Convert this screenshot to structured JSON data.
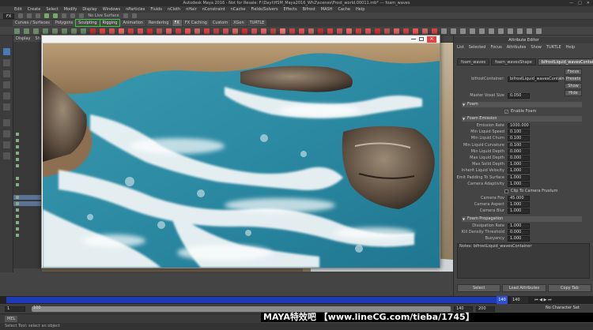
{
  "window": {
    "title": "Autodesk Maya 2016 - Not for Resale: F:\\Dayi\\HSM_Maya2016_Wh2\\scenes\\Frost_world.00011.mb*  ---  foam_waves"
  },
  "menu": [
    "Edit",
    "Create",
    "Select",
    "Modify",
    "Display",
    "Windows",
    "nParticles",
    "Fluids",
    "nCloth",
    "nHair",
    "nConstraint",
    "nCache",
    "Fields/Solvers",
    "Effects",
    "Bifrost",
    "MASH",
    "Cache",
    "Help"
  ],
  "status": {
    "mode": "FX",
    "live_surface": "No Live Surface"
  },
  "shelf_tabs": [
    {
      "label": "Curves / Surfaces",
      "state": ""
    },
    {
      "label": "Polygons",
      "state": ""
    },
    {
      "label": "Sculpting",
      "state": "hl"
    },
    {
      "label": "Rigging",
      "state": "hl"
    },
    {
      "label": "Animation",
      "state": ""
    },
    {
      "label": "Rendering",
      "state": ""
    },
    {
      "label": "FX",
      "state": "act"
    },
    {
      "label": "FX Caching",
      "state": ""
    },
    {
      "label": "Custom",
      "state": ""
    },
    {
      "label": "XGen",
      "state": ""
    },
    {
      "label": "TURTLE",
      "state": ""
    }
  ],
  "outliner": {
    "tabs": [
      "Display",
      "Sh"
    ]
  },
  "viewport_menu": [
    "View",
    "Shading",
    "Lighting",
    "Show",
    "Renderer",
    "Panels"
  ],
  "attribute_editor": {
    "title": "Attribute Editor",
    "menu": [
      "List",
      "Selected",
      "Focus",
      "Attributes",
      "Show",
      "TURTLE",
      "Help"
    ],
    "tabs": [
      "foam_waves",
      "foam_wavesShape",
      "bifrostLiquid_wavesContainer"
    ],
    "node_label": "bifrostContainer:",
    "node_value": "bifrostLiquid_wavesContainer",
    "focus_btn": "Focus",
    "presets_btn": "Presets",
    "show_btn": "Show",
    "hide_btn": "Hide",
    "master_voxel_label": "Master Voxel Size",
    "master_voxel_value": "0.050",
    "sections": {
      "foam": "Foam",
      "enable_foam": "Enable Foam",
      "emission": "Foam Emission",
      "propagation": "Foam Propagation"
    },
    "emission_rows": [
      {
        "label": "Emission Rate",
        "value": "1000.000"
      },
      {
        "label": "Min Liquid Speed",
        "value": "0.100"
      },
      {
        "label": "Min Liquid Churn",
        "value": "0.100"
      },
      {
        "label": "Min Liquid Curvature",
        "value": "0.100"
      },
      {
        "label": "Min Liquid Depth",
        "value": "0.000"
      },
      {
        "label": "Max Liquid Depth",
        "value": "0.000"
      },
      {
        "label": "Max Solid Depth",
        "value": "1.000"
      },
      {
        "label": "Inherit Liquid Velocity",
        "value": "1.000"
      },
      {
        "label": "Emit Padding To Surface",
        "value": "1.000"
      },
      {
        "label": "Camera Adaptivity",
        "value": "1.000"
      }
    ],
    "clip_label": "Clip To Camera Frustum",
    "camera_rows": [
      {
        "label": "Camera Fov",
        "value": "45.000"
      },
      {
        "label": "Camera Aspect",
        "value": "1.000"
      },
      {
        "label": "Camera Blur",
        "value": "1.000"
      }
    ],
    "prop_rows": [
      {
        "label": "Dissipation Rate",
        "value": "1.000"
      },
      {
        "label": "Kill Density Threshold",
        "value": "0.000"
      },
      {
        "label": "Buoyancy",
        "value": "1.000"
      }
    ],
    "notes_label": "Notes: bifrostLiquid_wavesContainer",
    "buttons": [
      "Select",
      "Load Attributes",
      "Copy Tab"
    ]
  },
  "timeline": {
    "current_frame": "140",
    "start": "1",
    "end": "140",
    "range_start": "100",
    "range_end": "140",
    "range_end2": "200",
    "no_char": "No Character Set"
  },
  "watermark": "MAYA特效吧  【www.lineCG.com/tieba/1745】",
  "cmdline": {
    "mel": "MEL"
  },
  "help_line": "Select Tool: select an object"
}
